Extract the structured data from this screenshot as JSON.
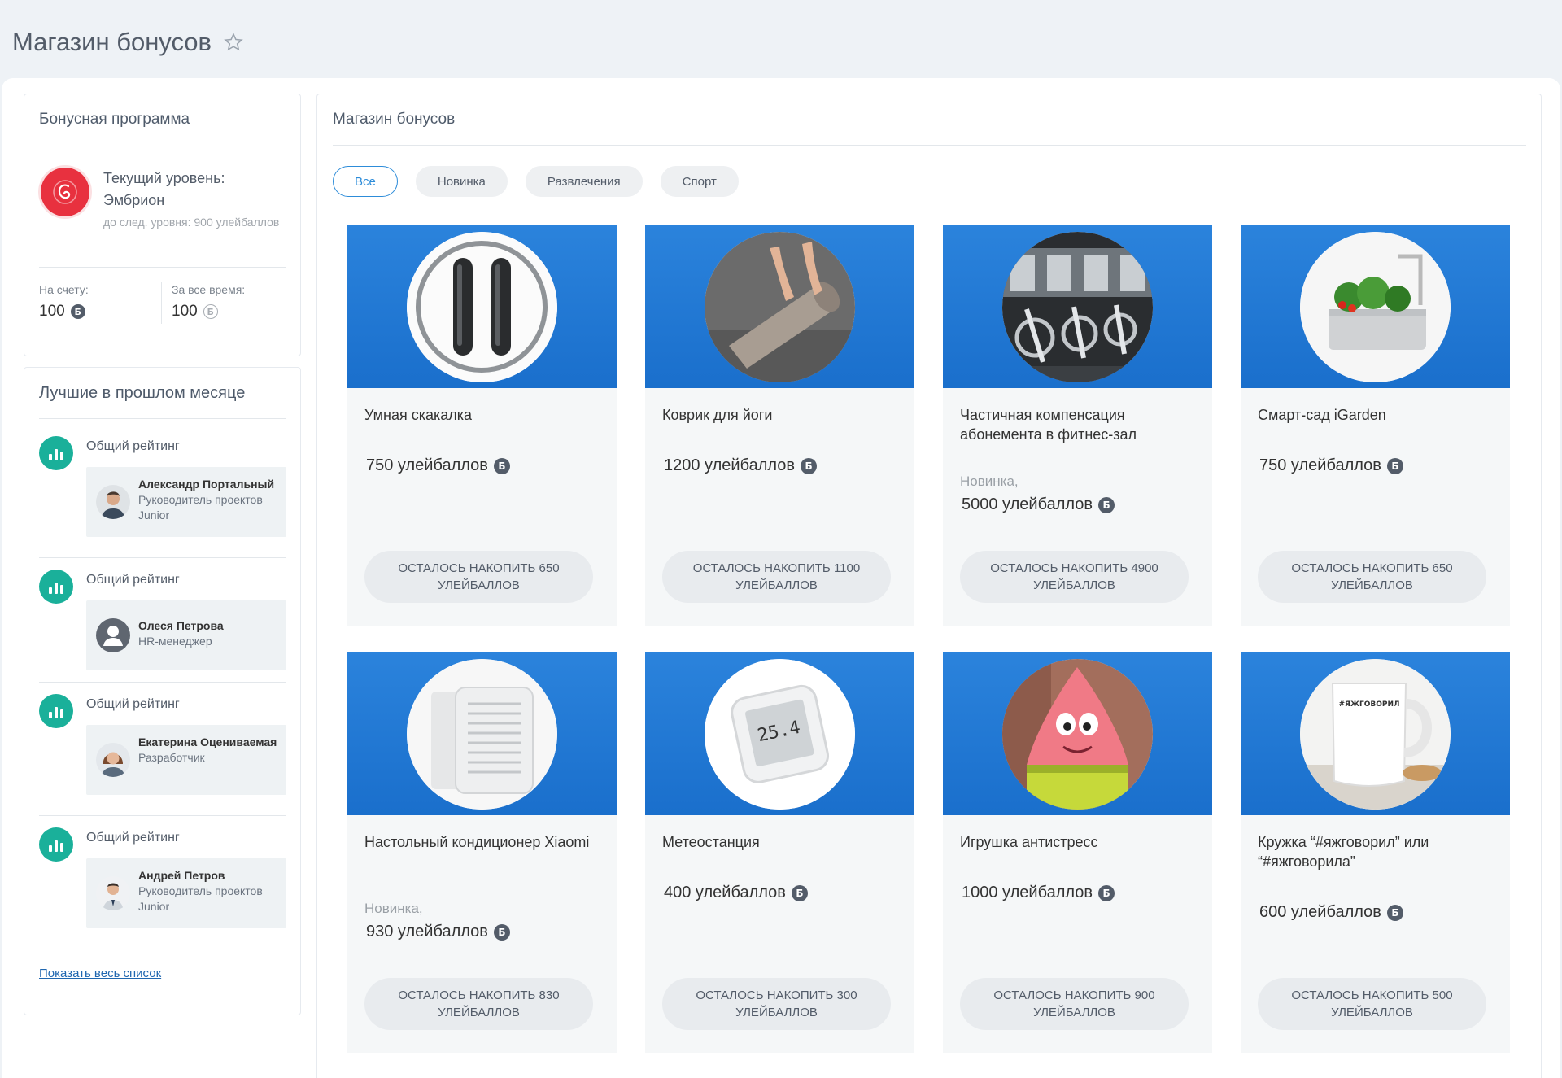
{
  "header": {
    "title": "Магазин бонусов"
  },
  "bonus": {
    "title": "Бонусная программа",
    "level_label": "Текущий уровень:",
    "level_name": "Эмбрион",
    "next_level": "до след. уровня: 900 улейбаллов",
    "balance_label": "На счету:",
    "balance_value": "100",
    "total_label": "За все время:",
    "total_value": "100",
    "coin_symbol": "Б"
  },
  "leaders": {
    "title": "Лучшие в прошлом месяце",
    "items": [
      {
        "rating": "Общий рейтинг",
        "name": "Александр Портальный",
        "role": "Руководитель проектов Junior",
        "avatar": "man-photo"
      },
      {
        "rating": "Общий рейтинг",
        "name": "Олеся Петрова",
        "role": "HR-менеджер",
        "avatar": "default-user"
      },
      {
        "rating": "Общий рейтинг",
        "name": "Екатерина Оцениваемая",
        "role": "Разработчик",
        "avatar": "woman-photo"
      },
      {
        "rating": "Общий рейтинг",
        "name": "Андрей Петров",
        "role": "Руководитель проектов Junior",
        "avatar": "man-photo-2"
      }
    ],
    "show_all": "Показать весь список"
  },
  "shop": {
    "title": "Магазин бонусов",
    "filters": [
      {
        "label": "Все",
        "active": true
      },
      {
        "label": "Новинка",
        "active": false
      },
      {
        "label": "Развлечения",
        "active": false
      },
      {
        "label": "Спорт",
        "active": false
      }
    ],
    "products": [
      {
        "title": "Умная скакалка",
        "tag": "",
        "price": "750 улейбаллов",
        "button": "ОСТАЛОСЬ НАКОПИТЬ 650 УЛЕЙБАЛЛОВ",
        "image": "jump-rope"
      },
      {
        "title": "Коврик для йоги",
        "tag": "",
        "price": "1200 улейбаллов",
        "button": "ОСТАЛОСЬ НАКОПИТЬ 1100 УЛЕЙБАЛЛОВ",
        "image": "yoga-mat"
      },
      {
        "title": "Частичная компенсация абонемента в фитнес-зал",
        "tag": "Новинка,",
        "price": "5000 улейбаллов",
        "button": "ОСТАЛОСЬ НАКОПИТЬ 4900 УЛЕЙБАЛЛОВ",
        "image": "gym"
      },
      {
        "title": "Смарт-сад iGarden",
        "tag": "",
        "price": "750 улейбаллов",
        "button": "ОСТАЛОСЬ НАКОПИТЬ 650 УЛЕЙБАЛЛОВ",
        "image": "smart-garden"
      },
      {
        "title": "Настольный кондиционер Xiaomi",
        "tag": "Новинка,",
        "price": "930 улейбаллов",
        "button": "ОСТАЛОСЬ НАКОПИТЬ 830 УЛЕЙБАЛЛОВ",
        "image": "air-conditioner"
      },
      {
        "title": "Метеостанция",
        "tag": "",
        "price": "400 улейбаллов",
        "button": "ОСТАЛОСЬ НАКОПИТЬ 300 УЛЕЙБАЛЛОВ",
        "image": "weather-station",
        "screen_text": "25.4"
      },
      {
        "title": "Игрушка антистресс",
        "tag": "",
        "price": "1000 улейбаллов",
        "button": "ОСТАЛОСЬ НАКОПИТЬ 900 УЛЕЙБАЛЛОВ",
        "image": "plush-toy"
      },
      {
        "title": "Кружка “#яжговорил” или “#яжговорила”",
        "tag": "",
        "price": "600 улейбаллов",
        "button": "ОСТАЛОСЬ НАКОПИТЬ 500 УЛЕЙБАЛЛОВ",
        "image": "mug",
        "mug_text": "#ЯЖГОВОРИЛ"
      }
    ]
  },
  "colors": {
    "accent": "#2d8cd9",
    "card_header": "#1a6fcc",
    "rating_icon": "#1ab09a",
    "level_badge": "#e8313f",
    "link": "#2067b0"
  }
}
